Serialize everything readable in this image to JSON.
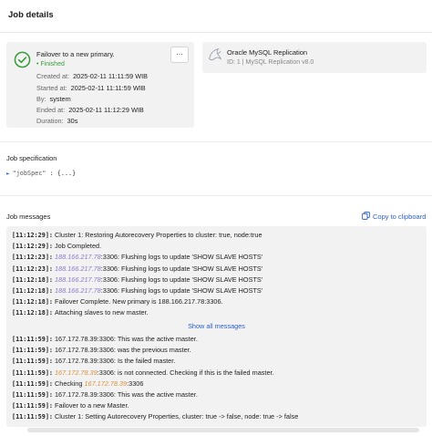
{
  "header": {
    "title": "Job details"
  },
  "status_card": {
    "title": "Failover to a new primary.",
    "status": "Finished",
    "status_color": "#3a9b3a",
    "rows": [
      {
        "key": "Created at:",
        "value": "2025-02-11 11:11:59 WIB"
      },
      {
        "key": "Started at:",
        "value": "2025-02-11 11:11:59 WIB"
      },
      {
        "key": "By:",
        "value": "system"
      },
      {
        "key": "Ended at:",
        "value": "2025-02-11 11:12:29 WIB"
      },
      {
        "key": "Duration:",
        "value": "30s"
      }
    ],
    "more_label": "..."
  },
  "service_card": {
    "name": "Oracle MySQL Replication",
    "subtitle": "ID: 1 | MySQL Replication v8.0",
    "icon": "mysql-dolphin-icon"
  },
  "job_spec": {
    "section_title": "Job specification",
    "key": "\"jobSpec\"",
    "value": ": {...}"
  },
  "job_messages": {
    "section_title": "Job messages",
    "copy_label": "Copy to clipboard",
    "show_all_label": "Show all messages",
    "top": [
      {
        "ts": "[11:12:29]:",
        "parts": [
          {
            "t": "Cluster 1: Restoring Autorecovery Properties to cluster: true, node:true"
          }
        ]
      },
      {
        "ts": "[11:12:29]:",
        "parts": [
          {
            "t": "Job Completed."
          }
        ]
      },
      {
        "ts": "[11:12:23]:",
        "parts": [
          {
            "t": "188.166.217.78",
            "c": "ip-purple"
          },
          {
            "t": ":3306: Flushing logs to update 'SHOW SLAVE HOSTS'"
          }
        ]
      },
      {
        "ts": "[11:12:23]:",
        "parts": [
          {
            "t": "188.166.217.78",
            "c": "ip-purple"
          },
          {
            "t": ":3306: Flushing logs to update 'SHOW SLAVE HOSTS'"
          }
        ]
      },
      {
        "ts": "[11:12:18]:",
        "parts": [
          {
            "t": "188.166.217.78",
            "c": "ip-purple"
          },
          {
            "t": ":3306: Flushing logs to update 'SHOW SLAVE HOSTS'"
          }
        ]
      },
      {
        "ts": "[11:12:18]:",
        "parts": [
          {
            "t": "188.166.217.78",
            "c": "ip-purple"
          },
          {
            "t": ":3306: Flushing logs to update 'SHOW SLAVE HOSTS'"
          }
        ]
      },
      {
        "ts": "[11:12:18]:",
        "parts": [
          {
            "t": "Failover Complete. New primary is 188.166.217.78:3306."
          }
        ]
      },
      {
        "ts": "[11:12:18]:",
        "parts": [
          {
            "t": "Attaching slaves to new master."
          }
        ]
      }
    ],
    "bottom": [
      {
        "ts": "[11:11:59]:",
        "parts": [
          {
            "t": "167.172.78.39:3306: This was the active master."
          }
        ]
      },
      {
        "ts": "[11:11:59]:",
        "parts": [
          {
            "t": "167.172.78.39:3306: was the previous master."
          }
        ]
      },
      {
        "ts": "[11:11:59]:",
        "parts": [
          {
            "t": "167.172.78.39:3306: Is the failed master."
          }
        ]
      },
      {
        "ts": "[11:11:59]:",
        "parts": [
          {
            "t": "167.172.78.39",
            "c": "ip-orange"
          },
          {
            "t": ":3306: is not connected. Checking if this is the failed master."
          }
        ]
      },
      {
        "ts": "[11:11:59]:",
        "parts": [
          {
            "t": "Checking "
          },
          {
            "t": "167.172.78.39",
            "c": "ip-orange"
          },
          {
            "t": ":3306"
          }
        ]
      },
      {
        "ts": "[11:11:59]:",
        "parts": [
          {
            "t": "167.172.78.39:3306: This was the active master."
          }
        ]
      },
      {
        "ts": "[11:11:59]:",
        "parts": [
          {
            "t": "Failover to a new Master."
          }
        ]
      },
      {
        "ts": "[11:11:59]:",
        "parts": [
          {
            "t": "Cluster 1: Setting Autorecovery Properties, cluster: true -> false, node: true -> false"
          }
        ]
      }
    ]
  }
}
